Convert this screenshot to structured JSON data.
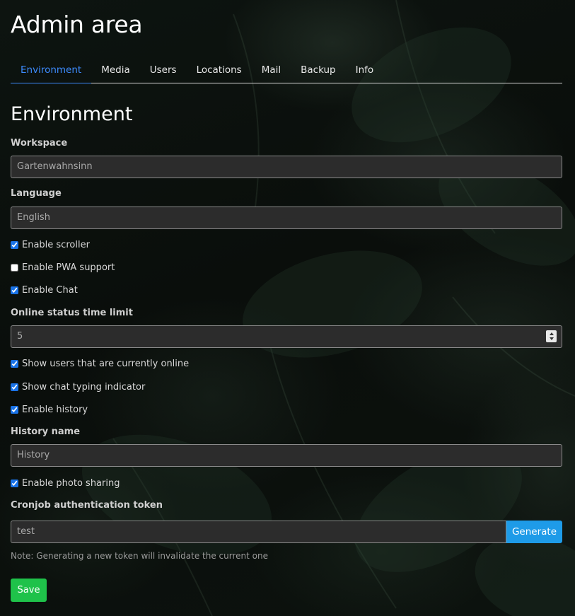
{
  "page": {
    "title": "Admin area"
  },
  "tabs": [
    {
      "label": "Environment",
      "active": true
    },
    {
      "label": "Media",
      "active": false
    },
    {
      "label": "Users",
      "active": false
    },
    {
      "label": "Locations",
      "active": false
    },
    {
      "label": "Mail",
      "active": false
    },
    {
      "label": "Backup",
      "active": false
    },
    {
      "label": "Info",
      "active": false
    }
  ],
  "section": {
    "title": "Environment"
  },
  "form": {
    "workspace": {
      "label": "Workspace",
      "value": "Gartenwahnsinn"
    },
    "language": {
      "label": "Language",
      "value": "English"
    },
    "enable_scroller": {
      "label": "Enable scroller",
      "checked": true
    },
    "enable_pwa": {
      "label": "Enable PWA support",
      "checked": false
    },
    "enable_chat": {
      "label": "Enable Chat",
      "checked": true
    },
    "online_limit": {
      "label": "Online status time limit",
      "value": "5"
    },
    "show_online": {
      "label": "Show users that are currently online",
      "checked": true
    },
    "typing_indicator": {
      "label": "Show chat typing indicator",
      "checked": true
    },
    "enable_history": {
      "label": "Enable history",
      "checked": true
    },
    "history_name": {
      "label": "History name",
      "value": "History"
    },
    "photo_sharing": {
      "label": "Enable photo sharing",
      "checked": true
    },
    "cron_token": {
      "label": "Cronjob authentication token",
      "value": "test",
      "generate_label": "Generate",
      "note": "Note: Generating a new token will invalidate the current one"
    },
    "save_label": "Save"
  },
  "colors": {
    "active_tab": "#3d8bfd",
    "generate_button": "#1e9be8",
    "save_button": "#1fc24a",
    "input_background": "#2c2c2c"
  }
}
